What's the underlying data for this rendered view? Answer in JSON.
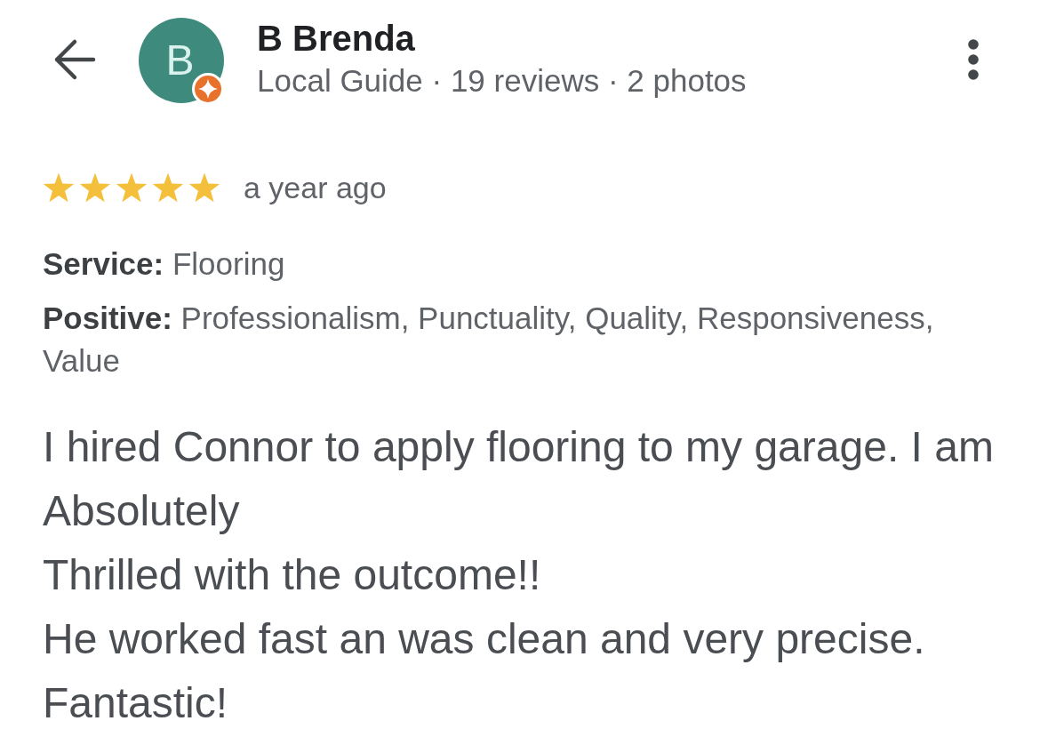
{
  "reviewer": {
    "initial": "B",
    "local_guide": true,
    "name": "B Brenda",
    "details": "Local Guide · 19 reviews · 2 photos"
  },
  "review": {
    "stars": 5,
    "time": "a year ago",
    "attributes": [
      {
        "label": "Service:",
        "value": "Flooring"
      },
      {
        "label": "Positive:",
        "value": "Professionalism, Punctuality, Quality, Responsiveness, Value"
      }
    ],
    "text": "I hired Connor to apply flooring to my garage. I am Absolutely\nThrilled with the outcome!!\nHe worked fast an was clean and very precise. Fantastic!"
  }
}
